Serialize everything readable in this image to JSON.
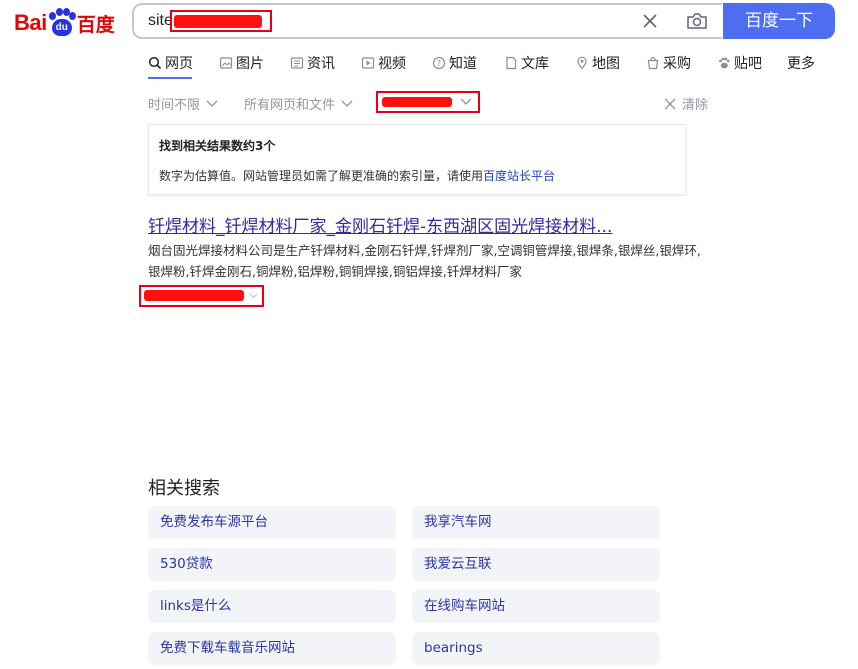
{
  "logo": {
    "left": "Bai",
    "paw_text": "du",
    "right": "百度",
    "alt": "Baidu"
  },
  "search": {
    "query_prefix": "site",
    "submit_label": "百度一下"
  },
  "icons": {
    "clear": "close-icon",
    "camera": "camera-icon"
  },
  "tabs": [
    {
      "label": "网页",
      "icon": "search-icon",
      "active": true
    },
    {
      "label": "图片",
      "icon": "image-icon"
    },
    {
      "label": "资讯",
      "icon": "news-icon"
    },
    {
      "label": "视频",
      "icon": "video-icon"
    },
    {
      "label": "知道",
      "icon": "question-icon"
    },
    {
      "label": "文库",
      "icon": "document-icon"
    },
    {
      "label": "地图",
      "icon": "map-pin-icon"
    },
    {
      "label": "采购",
      "icon": "shopping-bag-icon"
    },
    {
      "label": "贴吧",
      "icon": "paw-icon"
    },
    {
      "label": "更多",
      "icon": null
    }
  ],
  "filters": {
    "time": "时间不限",
    "type": "所有网页和文件",
    "clear": "清除"
  },
  "info": {
    "count_text": "找到相关结果数约3个",
    "note_prefix": "数字为估算值。网站管理员如需了解更准确的索引量，请使用",
    "note_link": "百度站长平台"
  },
  "result": {
    "title": "钎焊材料_钎焊材料厂家_金刚石钎焊-东西湖区固光焊接材料...",
    "snippet": "烟台固光焊接材料公司是生产钎焊材料,金刚石钎焊,钎焊剂厂家,空调铜管焊接,银焊条,银焊丝,银焊环,银焊粉,钎焊金刚石,铜焊粉,铝焊粉,铜铜焊接,铜铝焊接,钎焊材料厂家"
  },
  "related": {
    "heading": "相关搜索",
    "items": [
      "免费发布车源平台",
      "我享汽车网",
      "530贷款",
      "我爱云互联",
      "links是什么",
      "在线购车网站",
      "免费下载车载音乐网站",
      "bearings"
    ]
  },
  "colors": {
    "brand_red": "#e10602",
    "brand_blue": "#2932e1",
    "button_blue": "#4e6ef2",
    "link_purple": "#3529a3",
    "redaction": "#ff1010"
  }
}
